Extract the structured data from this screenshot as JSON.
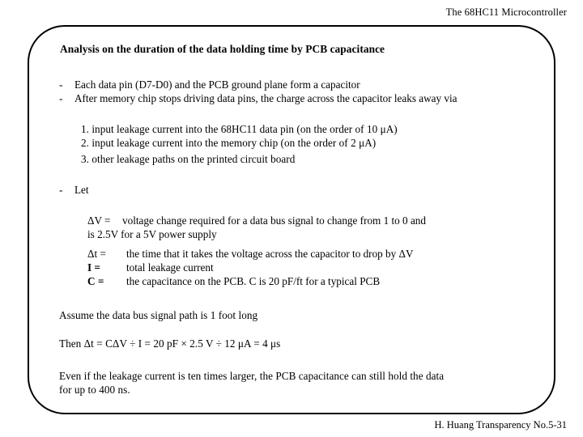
{
  "slide": {
    "header": "The 68HC11 Microcontroller",
    "footer": "H. Huang Transparency No.5-31",
    "title": "Analysis on the duration of the data holding time by PCB capacitance",
    "bullets": [
      {
        "marker": "-",
        "text": "Each data pin (D7-D0) and the PCB ground plane form a capacitor"
      },
      {
        "marker": "-",
        "text": "After memory chip stops driving data pins, the charge across the capacitor leaks away via"
      }
    ],
    "numbered_items": [
      "1. input leakage current into the 68HC11 data pin (on the order of 10 μA)",
      "2. input leakage current into the memory chip (on the order of 2 μA)",
      "3. other leakage paths on the printed circuit board"
    ],
    "let_marker": "-",
    "let_label": "Let",
    "definitions": [
      {
        "term": "ΔV =",
        "desc": "voltage change required for a data bus signal to change from 1 to 0 and"
      },
      {
        "term": "",
        "desc": "is 2.5V for a 5V power supply"
      },
      {
        "term": "Δt =",
        "desc": "the time that it takes the voltage across the capacitor to drop by ΔV"
      },
      {
        "term": "I =",
        "desc": "total leakage current"
      },
      {
        "term": "C =",
        "desc": "the capacitance on the PCB. C is 20 pF/ft for a typical PCB"
      }
    ],
    "assume_line": "Assume the data bus signal path is 1 foot long",
    "equation_line": "Then  Δt = CΔV ÷ I = 20 pF × 2.5 V ÷ 12  μA = 4 μs",
    "conclusion_line_1": "Even if the leakage current is ten times larger, the PCB capacitance can still hold the data",
    "conclusion_line_2": "for up to 400 ns.",
    "colors": {
      "text": "#000000",
      "background": "#ffffff",
      "frame_border": "#000000"
    }
  }
}
